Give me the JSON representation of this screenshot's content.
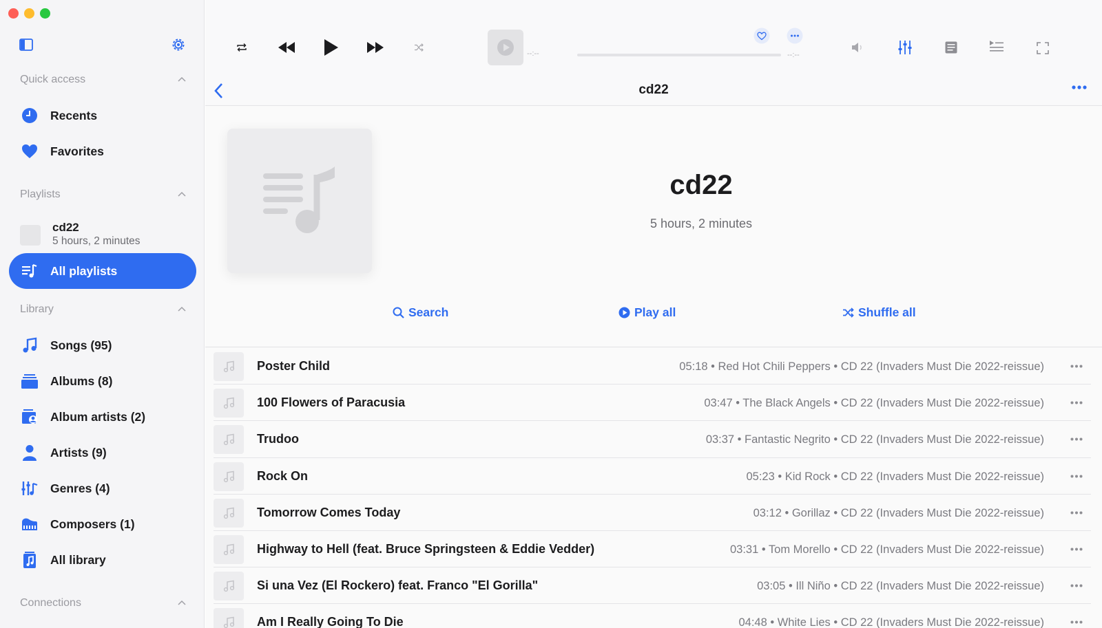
{
  "sidebar": {
    "quick_access": {
      "heading": "Quick access",
      "items": [
        {
          "label": "Recents",
          "icon": "clock-icon"
        },
        {
          "label": "Favorites",
          "icon": "heart-icon"
        }
      ]
    },
    "playlists": {
      "heading": "Playlists",
      "item": {
        "name": "cd22",
        "duration": "5 hours, 2 minutes"
      },
      "all_label": "All playlists"
    },
    "library": {
      "heading": "Library",
      "items": [
        {
          "label": "Songs (95)",
          "icon": "music-note-icon"
        },
        {
          "label": "Albums (8)",
          "icon": "albums-icon"
        },
        {
          "label": "Album artists (2)",
          "icon": "album-artists-icon"
        },
        {
          "label": "Artists (9)",
          "icon": "person-icon"
        },
        {
          "label": "Genres (4)",
          "icon": "genres-icon"
        },
        {
          "label": "Composers (1)",
          "icon": "piano-icon"
        },
        {
          "label": "All library",
          "icon": "library-icon"
        }
      ]
    },
    "connections": {
      "heading": "Connections"
    }
  },
  "player": {
    "time_elapsed": "--:--",
    "time_remaining": "--:--"
  },
  "nav": {
    "title": "cd22"
  },
  "playlist": {
    "title": "cd22",
    "duration": "5 hours, 2 minutes",
    "actions": {
      "search": "Search",
      "play_all": "Play all",
      "shuffle_all": "Shuffle all"
    }
  },
  "tracks": [
    {
      "title": "Poster Child",
      "meta": "05:18 • Red Hot Chili Peppers • CD 22 (Invaders Must Die 2022-reissue)"
    },
    {
      "title": "100 Flowers of Paracusia",
      "meta": "03:47 • The Black Angels • CD 22 (Invaders Must Die 2022-reissue)"
    },
    {
      "title": "Trudoo",
      "meta": "03:37 • Fantastic Negrito • CD 22 (Invaders Must Die 2022-reissue)"
    },
    {
      "title": "Rock On",
      "meta": "05:23 • Kid Rock • CD 22 (Invaders Must Die 2022-reissue)"
    },
    {
      "title": "Tomorrow Comes Today",
      "meta": "03:12 • Gorillaz • CD 22 (Invaders Must Die 2022-reissue)"
    },
    {
      "title": "Highway to Hell (feat. Bruce Springsteen & Eddie Vedder)",
      "meta": "03:31 • Tom Morello • CD 22 (Invaders Must Die 2022-reissue)"
    },
    {
      "title": "Si una Vez (El Rockero) feat. Franco \"El Gorilla\"",
      "meta": "03:05 • Ill Niño • CD 22 (Invaders Must Die 2022-reissue)"
    },
    {
      "title": "Am I Really Going To Die",
      "meta": "04:48 • White Lies • CD 22 (Invaders Must Die 2022-reissue)"
    }
  ],
  "colors": {
    "accent": "#2f6cf0",
    "sidebar_bg": "#f5f5f7"
  }
}
